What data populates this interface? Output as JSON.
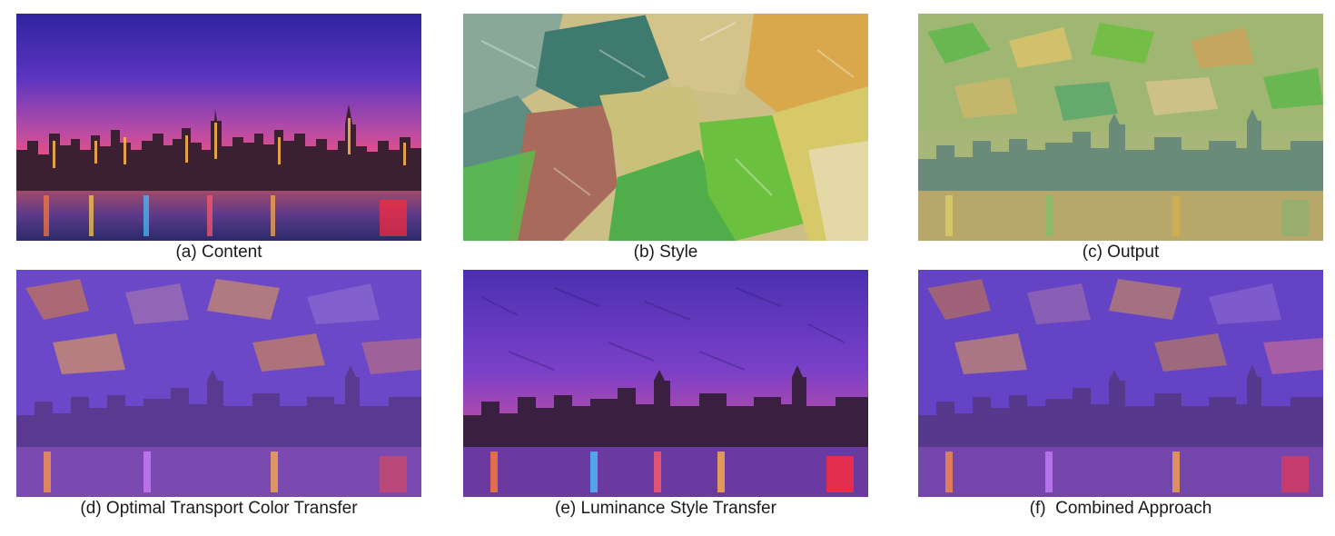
{
  "figure": {
    "panels": [
      {
        "id": "a",
        "caption": "(a) Content",
        "image": "night city skyline photo"
      },
      {
        "id": "b",
        "caption": "(b) Style",
        "image": "impasto oil paint texture"
      },
      {
        "id": "c",
        "caption": "(c) Output",
        "image": "stylized skyline with painting colors"
      },
      {
        "id": "d",
        "caption": "(d) Optimal Transport Color Transfer",
        "image": "stylized skyline color-transferred"
      },
      {
        "id": "e",
        "caption": "(e) Luminance Style Transfer",
        "image": "stylized skyline preserving original colors"
      },
      {
        "id": "f",
        "caption": "(f)  Combined Approach",
        "image": "stylized skyline combined method"
      }
    ]
  },
  "colors": {
    "night_sky_top": "#3a2a9a",
    "night_sky_mid": "#6a3cc8",
    "night_horizon": "#e0508a",
    "city_lights": "#ff8a3a",
    "paint_green": "#5fb84a",
    "paint_yellow": "#d9c36a",
    "paint_teal": "#5a8a86",
    "paint_red": "#9a4a40"
  }
}
